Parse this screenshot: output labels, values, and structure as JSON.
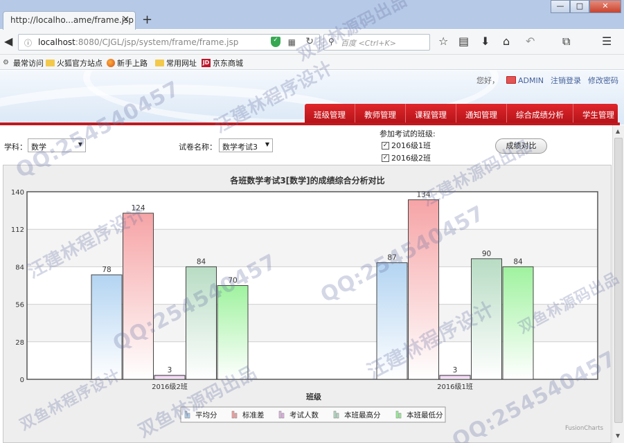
{
  "browser": {
    "tab_title": "http://localho...ame/frame.jsp",
    "url_host": "localhost",
    "url_rest": ":8080/CJGL/jsp/system/frame/frame.jsp",
    "search_placeholder": "百度 <Ctrl+K>",
    "window_buttons": [
      "—",
      "□",
      "✕"
    ]
  },
  "bookmarks": [
    "最常访问",
    "火狐官方站点",
    "新手上路",
    "常用网址",
    "京东商城"
  ],
  "header": {
    "greeting": "您好，",
    "user": "ADMIN",
    "logout": "注销登录",
    "change_password": "修改密码",
    "menu": [
      "班级管理",
      "教师管理",
      "课程管理",
      "通知管理",
      "综合成绩分析",
      "学生管理"
    ]
  },
  "filters": {
    "subject_label": "学科：",
    "subject_value": "数学",
    "exam_label": "试卷名称：",
    "exam_value": "数学考试3",
    "classes_label": "参加考试的班级:",
    "classes": [
      {
        "label": "2016级1班",
        "checked": true
      },
      {
        "label": "2016级2班",
        "checked": true
      }
    ],
    "compare_button": "成绩对比"
  },
  "chart_data": {
    "type": "bar",
    "title": "各班数学考试3[数学]的成绩综合分析对比",
    "xlabel": "班级",
    "ylabel": "",
    "categories": [
      "2016级2班",
      "2016级1班"
    ],
    "ylim": [
      0,
      140
    ],
    "yticks": [
      0,
      28,
      56,
      84,
      112,
      140
    ],
    "series": [
      {
        "name": "平均分",
        "color": "#b3d4f2",
        "values": [
          78,
          87
        ]
      },
      {
        "name": "标准差",
        "color": "#f6a4a6",
        "values": [
          124,
          134
        ]
      },
      {
        "name": "考试人数",
        "color": "#e2b8e6",
        "values": [
          3,
          3
        ]
      },
      {
        "name": "本班最高分",
        "color": "#b8dcc4",
        "values": [
          84,
          90
        ]
      },
      {
        "name": "本班最低分",
        "color": "#9ff29f",
        "values": [
          70,
          84
        ]
      }
    ],
    "legend": "bottom-center",
    "grid": true,
    "credit": "FusionCharts"
  },
  "watermarks": [
    "QQ:254540457",
    "汪建林程序设计",
    "双鱼林源码出品",
    "QQ:254540457",
    "汪建林程序设计",
    "双鱼林源码出品",
    "QQ:254540457",
    "汪建林程序设计",
    "双鱼林源码出品",
    "QQ:254540457",
    "双鱼林程序设计",
    "汪建林源码出品"
  ]
}
